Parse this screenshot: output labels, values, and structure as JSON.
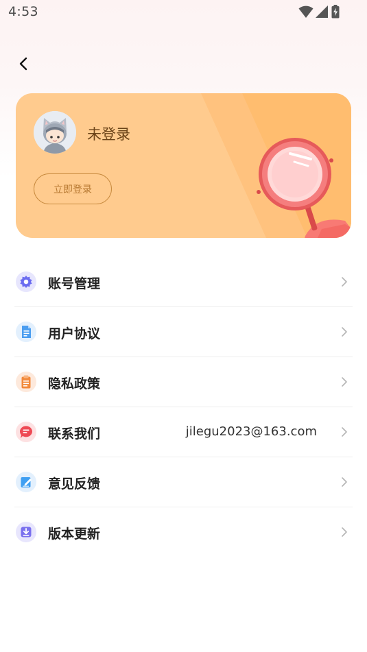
{
  "status_bar": {
    "time": "4:53",
    "icons": [
      "wifi-icon",
      "cellular-signal-icon",
      "battery-charging-icon"
    ]
  },
  "nav": {
    "back_icon": "chevron-left-icon"
  },
  "profile": {
    "username": "未登录",
    "login_button": "立即登录",
    "avatar_icon": "cat-hood-avatar",
    "decoration_icon": "magnifier-mirror-icon",
    "colors": {
      "card": "#ffcb8e",
      "card_accent": "#ffbd6f",
      "button_border": "#c7893d"
    }
  },
  "menu": {
    "items": [
      {
        "label": "账号管理",
        "icon": "gear-icon",
        "color": "#6b6cf0",
        "value": ""
      },
      {
        "label": "用户协议",
        "icon": "document-icon",
        "color": "#4a9df0",
        "value": ""
      },
      {
        "label": "隐私政策",
        "icon": "clipboard-icon",
        "color": "#f28a3c",
        "value": ""
      },
      {
        "label": "联系我们",
        "icon": "chat-bubble-icon",
        "color": "#ee4a55",
        "value": "jilegu2023@163.com"
      },
      {
        "label": "意见反馈",
        "icon": "edit-icon",
        "color": "#3f9ff2",
        "value": ""
      },
      {
        "label": "版本更新",
        "icon": "download-icon",
        "color": "#7a70ee",
        "value": ""
      }
    ]
  }
}
